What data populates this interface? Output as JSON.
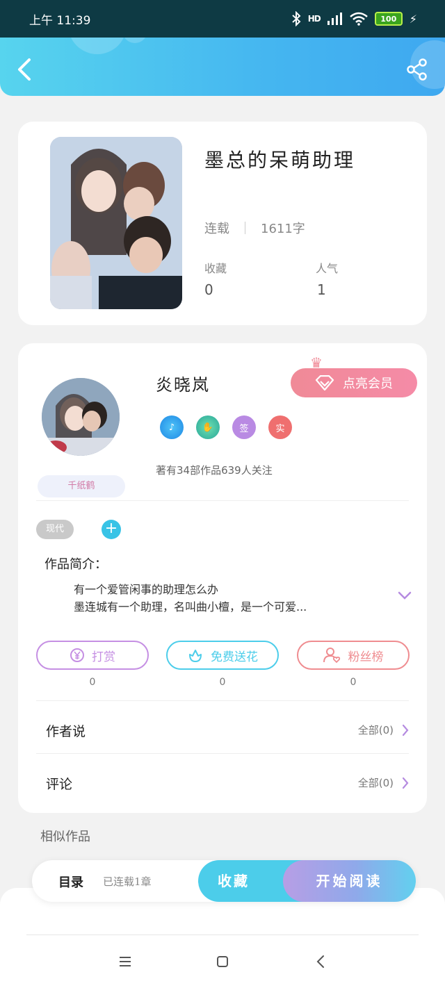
{
  "status_bar": {
    "time": "上午 11:39",
    "network": "HD",
    "battery": "100",
    "icons": [
      "bluetooth-icon",
      "signal-icon",
      "wifi-icon",
      "battery-icon",
      "charging-icon"
    ]
  },
  "header": {
    "back_icon": "chevron-left-icon",
    "share_icon": "share-icon",
    "gradient_start": "#57d4ee",
    "gradient_end": "#3ea8f0"
  },
  "book": {
    "title": "墨总的呆萌助理",
    "status": "连载",
    "word_count": "1611字",
    "stats": [
      {
        "label": "收藏",
        "value": "0"
      },
      {
        "label": "人气",
        "value": "1"
      }
    ]
  },
  "author": {
    "name": "炎晓岚",
    "avatar_tag": "千纸鹤",
    "vip_button": "点亮会员",
    "badges": [
      "music-badge-icon",
      "handshake-badge-icon",
      "签",
      "实"
    ],
    "summary": "著有34部作品639人关注"
  },
  "tags": {
    "genre": "现代",
    "add": "+"
  },
  "intro": {
    "title": "作品简介：",
    "lines": [
      "有一个爱管闲事的助理怎么办",
      "墨连城有一个助理，名叫曲小檀，是一个可爱..."
    ]
  },
  "actions": [
    {
      "label": "打赏",
      "count": "0",
      "color": "#c58fe3",
      "icon": "yen-coin-icon"
    },
    {
      "label": "免费送花",
      "count": "0",
      "color": "#4ccdea",
      "icon": "flower-icon"
    },
    {
      "label": "粉丝榜",
      "count": "0",
      "color": "#ef8c90",
      "icon": "fan-heart-icon"
    }
  ],
  "sections": [
    {
      "title": "作者说",
      "link": "全部(0)"
    },
    {
      "title": "评论",
      "link": "全部(0)"
    }
  ],
  "similar": {
    "title": "相似作品"
  },
  "bottom_bar": {
    "toc": "目录",
    "toc_status": "已连载1章",
    "collect": "收藏",
    "start_reading": "开始阅读"
  },
  "system_nav": [
    "menu-icon",
    "home-icon",
    "back-icon"
  ]
}
